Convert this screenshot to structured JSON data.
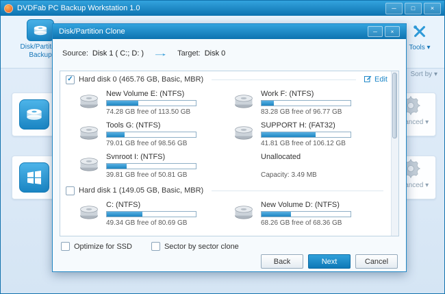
{
  "window": {
    "title": "DVDFab PC Backup Workstation 1.0",
    "controls": {
      "minimize": "─",
      "maximize": "□",
      "close": "×"
    }
  },
  "icons": {
    "check": "✓",
    "caret": "▾",
    "arrow": "→"
  },
  "nav": {
    "backup_tab": "Disk/Partition Backup",
    "tools": "Tools",
    "sort_by": "Sort by",
    "advanced": "Advanced"
  },
  "dialog": {
    "title": "Disk/Partition Clone",
    "controls": {
      "minimize": "─",
      "close": "×"
    },
    "source_label": "Source:",
    "source_value": "Disk 1 ( C:; D: )",
    "target_label": "Target:",
    "target_value": "Disk 0",
    "edit_link": "Edit",
    "disks": [
      {
        "label": "Hard disk 0 (465.76 GB, Basic, MBR)",
        "checked": true,
        "partitions": [
          {
            "name": "New Volume E: (NTFS)",
            "detail": "74.28 GB free of 113.50 GB",
            "used_percent": 35,
            "icon": true,
            "bar": true
          },
          {
            "name": "Work F: (NTFS)",
            "detail": "83.28 GB free of 96.77 GB",
            "used_percent": 14,
            "icon": true,
            "bar": true
          },
          {
            "name": "Tools G: (NTFS)",
            "detail": "79.01 GB free of 98.56 GB",
            "used_percent": 20,
            "icon": true,
            "bar": true
          },
          {
            "name": "SUPPORT H: (FAT32)",
            "detail": "41.81 GB free of 106.12 GB",
            "used_percent": 61,
            "icon": true,
            "bar": true
          },
          {
            "name": "Svnroot I: (NTFS)",
            "detail": "39.81 GB free of 50.81 GB",
            "used_percent": 22,
            "icon": true,
            "bar": true
          },
          {
            "name": "Unallocated",
            "detail": "Capacity: 3.49 MB",
            "used_percent": 0,
            "icon": false,
            "bar": false
          }
        ]
      },
      {
        "label": "Hard disk 1 (149.05 GB, Basic, MBR)",
        "checked": false,
        "partitions": [
          {
            "name": "C: (NTFS)",
            "detail": "49.34 GB free of 80.69 GB",
            "used_percent": 40,
            "icon": true,
            "bar": true
          },
          {
            "name": "New Volume D: (NTFS)",
            "detail": "68.26 GB free of 68.36 GB",
            "used_percent": 33,
            "icon": true,
            "bar": true
          }
        ]
      }
    ],
    "options": [
      {
        "label": "Optimize for SSD",
        "checked": false
      },
      {
        "label": "Sector by sector clone",
        "checked": false
      }
    ],
    "buttons": {
      "back": "Back",
      "next": "Next",
      "cancel": "Cancel"
    }
  }
}
